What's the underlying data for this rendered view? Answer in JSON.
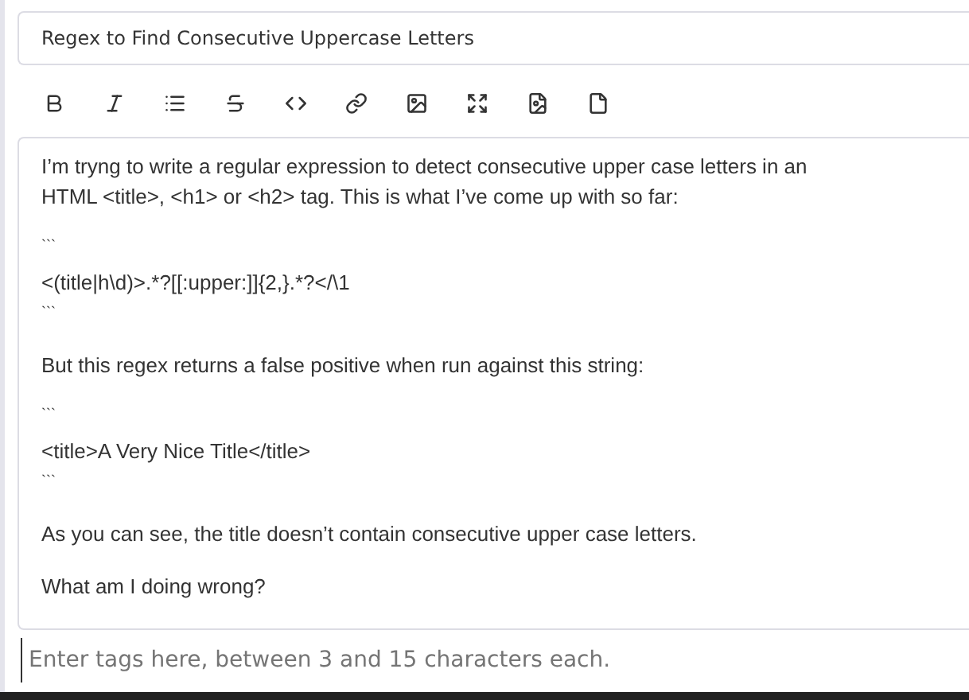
{
  "title_field": {
    "value": "Regex to Find Consecutive Uppercase Letters"
  },
  "toolbar": [
    {
      "kind": "bold"
    },
    {
      "kind": "italic"
    },
    {
      "kind": "list"
    },
    {
      "kind": "strike"
    },
    {
      "kind": "code"
    },
    {
      "kind": "link"
    },
    {
      "kind": "image"
    },
    {
      "kind": "fullscreen"
    },
    {
      "kind": "file-image"
    },
    {
      "kind": "file"
    }
  ],
  "body": [
    {
      "kind": "para",
      "text": "I’m tryng to write a regular expression to detect consecutive upper case letters in an HTML <title>, <h1> or <h2> tag. This is what I’ve come up with so far:"
    },
    {
      "kind": "fence",
      "text": "```"
    },
    {
      "kind": "code",
      "text": "<(title|h\\d)>.*?[[:upper:]]{2,}.*?</\\1"
    },
    {
      "kind": "fence",
      "text": "```"
    },
    {
      "kind": "para",
      "text": "But this regex returns a false positive when run against this string:"
    },
    {
      "kind": "fence",
      "text": "```"
    },
    {
      "kind": "code",
      "text": "<title>A Very Nice Title</title>"
    },
    {
      "kind": "fence",
      "text": "```"
    },
    {
      "kind": "para",
      "text": "As you can see, the title doesn’t contain consecutive upper case letters."
    },
    {
      "kind": "para",
      "text": "What am I doing wrong?"
    }
  ],
  "tags_field": {
    "placeholder": "Enter tags here, between 3 and 15 characters each."
  }
}
